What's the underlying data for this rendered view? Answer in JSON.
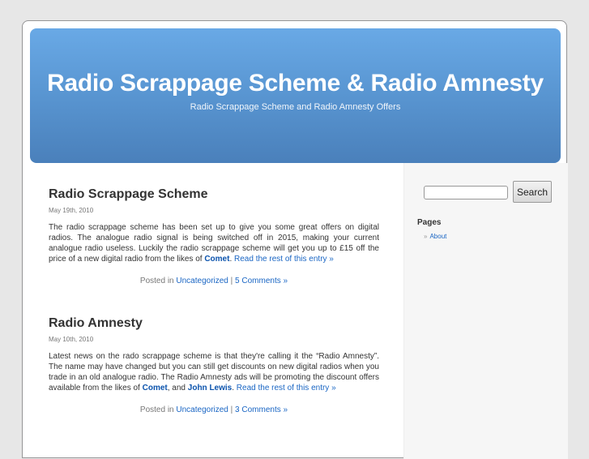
{
  "header": {
    "title": "Radio Scrappage Scheme & Radio Amnesty",
    "description": "Radio Scrappage Scheme and Radio Amnesty Offers"
  },
  "posts": [
    {
      "title": "Radio Scrappage Scheme",
      "date": "May 19th, 2010",
      "body_text": "The radio scrappage scheme has been set up to give you some great offers on digital radios. The analogue radio signal is being switched off in 2015, making your current analogue radio useless. Luckily the radio scrappage scheme will get you up to £15 off the price of a new digital radio from the likes of ",
      "links": [
        "Comet"
      ],
      "after_links": ". ",
      "read_more": "Read the rest of this entry »",
      "posted_in": "Posted in",
      "category": "Uncategorized",
      "separator": "|",
      "comments": "5 Comments »"
    },
    {
      "title": "Radio Amnesty",
      "date": "May 10th, 2010",
      "body_text": "Latest news on the rado scrappage scheme is that they're calling it the “Radio Amnesty”. The name may have changed but you can still get discounts on new digital radios when you trade in an old analogue radio. The Radio Amnesty ads will be promoting the discount offers available from the likes of ",
      "links": [
        "Comet",
        "John Lewis"
      ],
      "between_links": ", and ",
      "after_links": ". ",
      "read_more": "Read the rest of this entry »",
      "posted_in": "Posted in",
      "category": "Uncategorized",
      "separator": "|",
      "comments": "3 Comments »"
    }
  ],
  "sidebar": {
    "search": {
      "value": "",
      "placeholder": "",
      "button_label": "Search"
    },
    "pages_title": "Pages",
    "pages": [
      {
        "bullet": "»",
        "label": "About"
      }
    ]
  },
  "colors": {
    "header_top": "#69a9e6",
    "header_bottom": "#4a80bb",
    "link": "#1a66c4"
  }
}
